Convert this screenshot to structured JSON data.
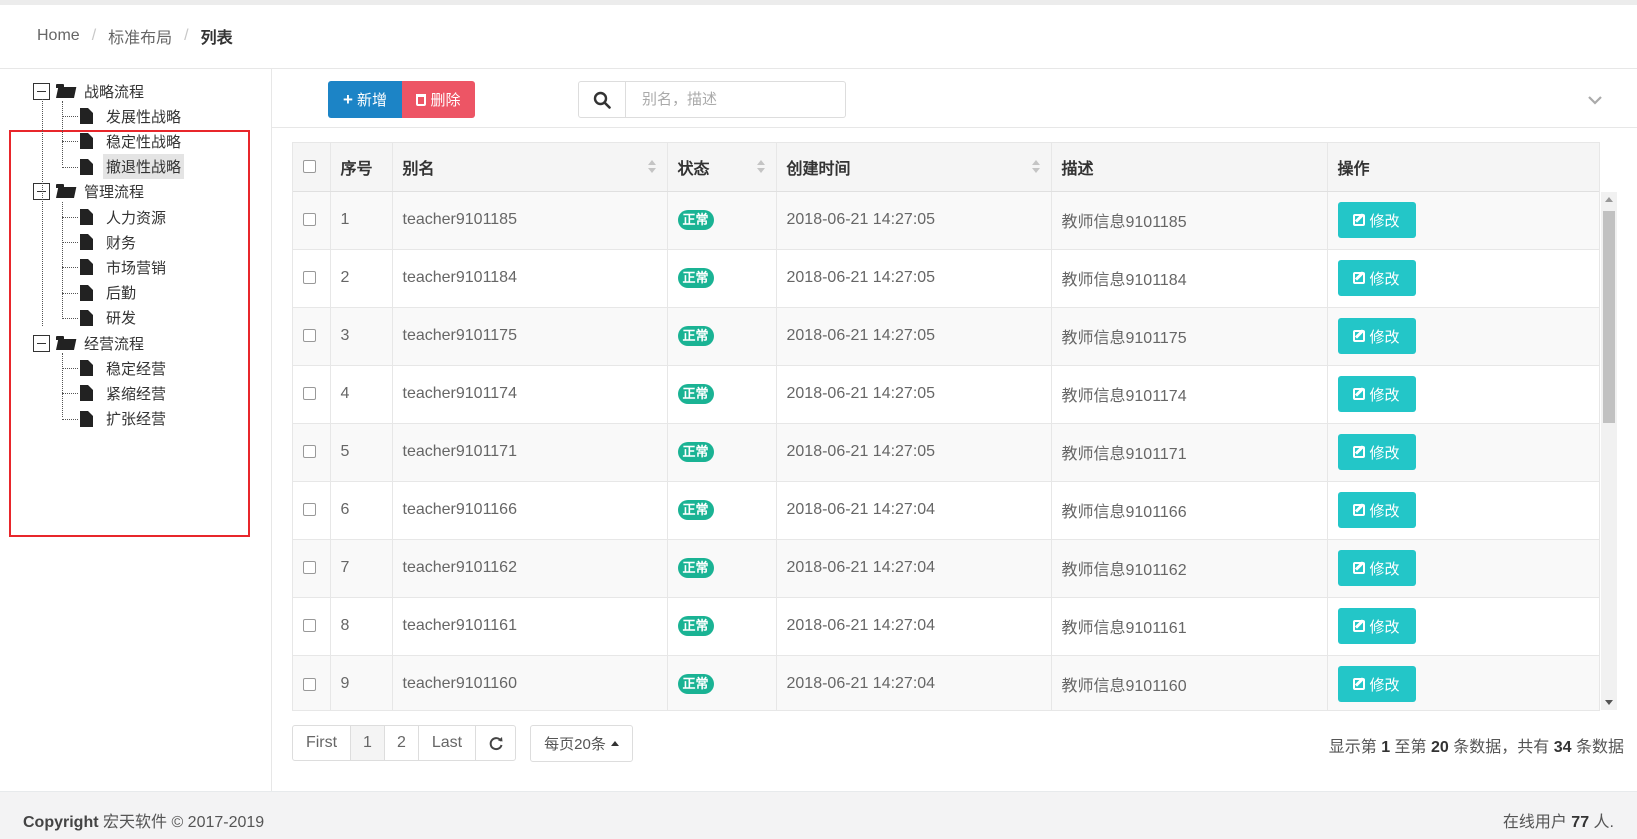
{
  "breadcrumb": {
    "home": "Home",
    "parent": "标准布局",
    "current": "列表",
    "separator": "/"
  },
  "tree": [
    {
      "label": "战略流程",
      "children": [
        "发展性战略",
        "稳定性战略",
        "撤退性战略"
      ]
    },
    {
      "label": "管理流程",
      "children": [
        "人力资源",
        "财务",
        "市场营销",
        "后勤",
        "研发"
      ]
    },
    {
      "label": "经营流程",
      "children": [
        "稳定经营",
        "紧缩经营",
        "扩张经营"
      ]
    }
  ],
  "tree_selected": "撤退性战略",
  "toolbar": {
    "add_label": "新增",
    "delete_label": "删除",
    "search_placeholder": "别名，描述",
    "add_color": "#1c84c6",
    "delete_color": "#ed5565"
  },
  "icons": {
    "search": "search-icon",
    "collapse": "chevron-down-icon",
    "edit": "edit-icon",
    "refresh": "refresh-icon",
    "add": "plus-icon",
    "delete": "trash-icon"
  },
  "table": {
    "headers": {
      "index": "序号",
      "alias": "别名",
      "status": "状态",
      "created": "创建时间",
      "desc": "描述",
      "action": "操作"
    },
    "edit_label": "修改",
    "status_color": "#1ab394",
    "edit_color": "#23c6c8",
    "rows": [
      {
        "index": "1",
        "alias": "teacher9101185",
        "status": "正常",
        "created": "2018-06-21 14:27:05",
        "desc": "教师信息9101185"
      },
      {
        "index": "2",
        "alias": "teacher9101184",
        "status": "正常",
        "created": "2018-06-21 14:27:05",
        "desc": "教师信息9101184"
      },
      {
        "index": "3",
        "alias": "teacher9101175",
        "status": "正常",
        "created": "2018-06-21 14:27:05",
        "desc": "教师信息9101175"
      },
      {
        "index": "4",
        "alias": "teacher9101174",
        "status": "正常",
        "created": "2018-06-21 14:27:05",
        "desc": "教师信息9101174"
      },
      {
        "index": "5",
        "alias": "teacher9101171",
        "status": "正常",
        "created": "2018-06-21 14:27:05",
        "desc": "教师信息9101171"
      },
      {
        "index": "6",
        "alias": "teacher9101166",
        "status": "正常",
        "created": "2018-06-21 14:27:04",
        "desc": "教师信息9101166"
      },
      {
        "index": "7",
        "alias": "teacher9101162",
        "status": "正常",
        "created": "2018-06-21 14:27:04",
        "desc": "教师信息9101162"
      },
      {
        "index": "8",
        "alias": "teacher9101161",
        "status": "正常",
        "created": "2018-06-21 14:27:04",
        "desc": "教师信息9101161"
      },
      {
        "index": "9",
        "alias": "teacher9101160",
        "status": "正常",
        "created": "2018-06-21 14:27:04",
        "desc": "教师信息9101160"
      }
    ]
  },
  "pagination": {
    "first": "First",
    "pages": [
      "1",
      "2"
    ],
    "active_page": "1",
    "last": "Last",
    "page_size_label": "每页20条",
    "info_prefix": "显示第",
    "info_from": "1",
    "info_mid1": "至第",
    "info_to": "20",
    "info_mid2": "条数据，共有",
    "info_total": "34",
    "info_suffix": "条数据"
  },
  "footer": {
    "copyright_label": "Copyright",
    "copyright_text": "宏天软件 © 2017-2019",
    "online_prefix": "在线用户",
    "online_count": "77",
    "online_suffix": "人."
  }
}
